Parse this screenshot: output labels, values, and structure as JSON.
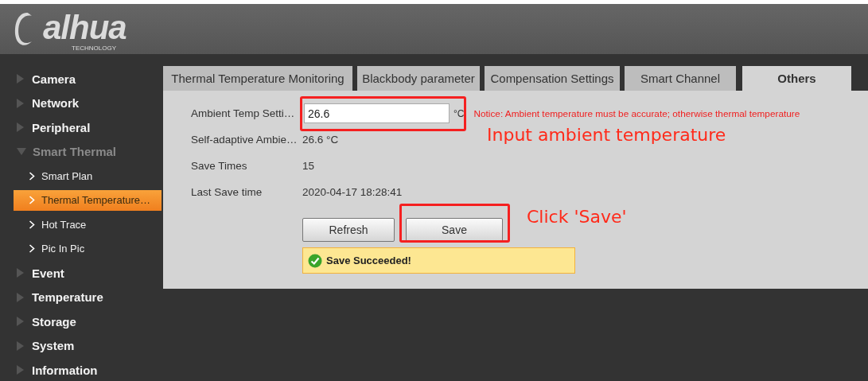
{
  "logo": {
    "name": "alhua",
    "tagline": "TECHNOLOGY"
  },
  "sidebar": {
    "items": [
      {
        "label": "Camera",
        "expanded": false
      },
      {
        "label": "Network",
        "expanded": false
      },
      {
        "label": "Peripheral",
        "expanded": false
      },
      {
        "label": "Smart Thermal",
        "expanded": true,
        "children": [
          {
            "label": "Smart Plan",
            "selected": false
          },
          {
            "label": "Thermal Temperature…",
            "selected": true
          },
          {
            "label": "Hot Trace",
            "selected": false
          },
          {
            "label": "Pic In Pic",
            "selected": false
          }
        ]
      },
      {
        "label": "Event",
        "expanded": false
      },
      {
        "label": "Temperature",
        "expanded": false
      },
      {
        "label": "Storage",
        "expanded": false
      },
      {
        "label": "System",
        "expanded": false
      },
      {
        "label": "Information",
        "expanded": false
      }
    ]
  },
  "tabs": [
    {
      "label": "Thermal Temperature Monitoring",
      "selected": false
    },
    {
      "label": "Blackbody parameter",
      "selected": false
    },
    {
      "label": "Compensation Settings",
      "selected": false
    },
    {
      "label": "Smart Channel",
      "selected": false
    },
    {
      "label": "Others",
      "selected": true
    }
  ],
  "form": {
    "ambient": {
      "label": "Ambient Temp Setti…",
      "value": "26.6",
      "unit": "°C",
      "notice": "Notice: Ambient temperature must be accurate; otherwise thermal temperature"
    },
    "rows": [
      {
        "label": "Self-adaptive Ambie…",
        "value": "26.6 °C"
      },
      {
        "label": "Save Times",
        "value": "15"
      },
      {
        "label": "Last Save time",
        "value": "2020-04-17 18:28:41"
      }
    ],
    "buttons": [
      {
        "label": "Refresh",
        "kind": "refresh"
      },
      {
        "label": "Save",
        "kind": "save"
      }
    ],
    "message": {
      "text": "Save Succeeded!",
      "kind": "success"
    }
  },
  "annotations": [
    {
      "text": "Input ambient temperature",
      "kind": "input"
    },
    {
      "text": "Click 'Save'",
      "kind": "save"
    }
  ]
}
